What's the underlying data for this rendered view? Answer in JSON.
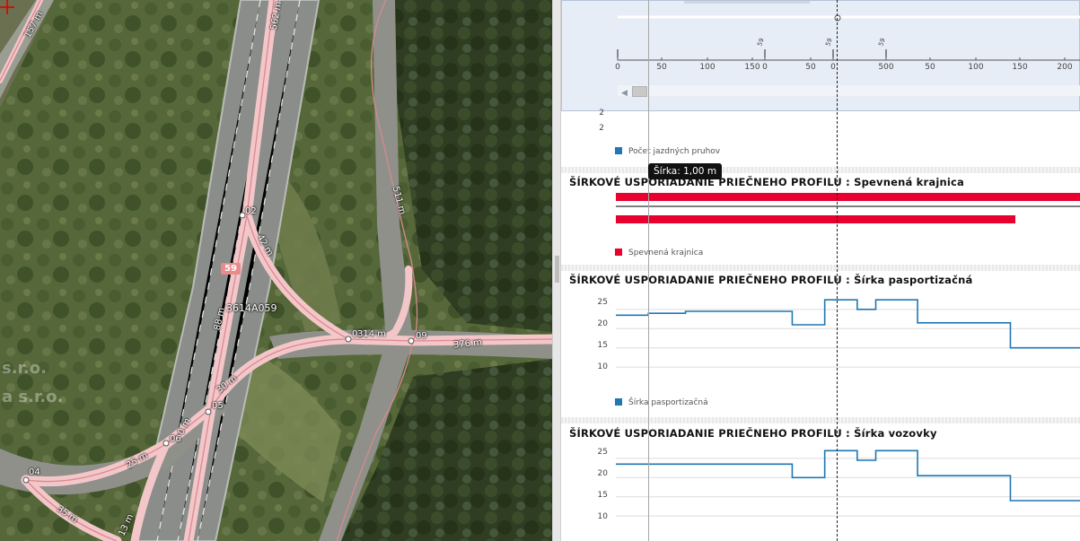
{
  "map": {
    "road_number": "59",
    "segment_id": "3614A059",
    "watermark_lines": [
      "s.r.o.",
      "a s.r.o."
    ],
    "labels": [
      {
        "text": "157 m",
        "name": "dist-157"
      },
      {
        "text": "562 m",
        "name": "dist-562"
      },
      {
        "text": "02",
        "name": "node-02"
      },
      {
        "text": "42 m",
        "name": "dist-42"
      },
      {
        "text": "511 m",
        "name": "dist-511"
      },
      {
        "text": "88 m",
        "name": "dist-88"
      },
      {
        "text": "03",
        "name": "node-03"
      },
      {
        "text": "314 m",
        "name": "dist-314"
      },
      {
        "text": "09",
        "name": "node-09"
      },
      {
        "text": "376 m",
        "name": "dist-376"
      },
      {
        "text": "30 m",
        "name": "dist-30"
      },
      {
        "text": "05",
        "name": "node-05"
      },
      {
        "text": "0 m",
        "name": "dist-0"
      },
      {
        "text": "06",
        "name": "node-06"
      },
      {
        "text": "25 m",
        "name": "dist-25"
      },
      {
        "text": "04",
        "name": "node-04"
      },
      {
        "text": "35 m",
        "name": "dist-35"
      },
      {
        "text": "13 m",
        "name": "dist-13"
      }
    ]
  },
  "overview": {
    "axis_ticks": [
      "0",
      "50",
      "100",
      "150",
      "0",
      "50",
      "0",
      "500",
      "50",
      "100",
      "150",
      "200"
    ],
    "markers": [
      "59",
      "59",
      "59"
    ],
    "cursor_marker": "0"
  },
  "tooltip": {
    "text": "Šírka: 1,00 m"
  },
  "sections": [
    {
      "id": "pocet",
      "title": "",
      "legend": "Počet jazdných pruhov",
      "legend_color": "#1f77b4",
      "y_ticks": [
        "2"
      ]
    },
    {
      "id": "krajnica",
      "title": "ŠÍRKOVÉ USPORIADANIE PRIEČNEHO PROFILU : Spevnená krajnica",
      "legend": "Spevnená krajnica",
      "legend_color": "#e8002e"
    },
    {
      "id": "pasport",
      "title": "ŠÍRKOVÉ USPORIADANIE PRIEČNEHO PROFILU : Šírka pasportizačná",
      "legend": "Šírka pasportizačná",
      "legend_color": "#1f77b4",
      "y_ticks": [
        "25",
        "20",
        "15",
        "10"
      ]
    },
    {
      "id": "vozovka",
      "title": "ŠÍRKOVÉ USPORIADANIE PRIEČNEHO PROFILU : Šírka vozovky",
      "legend": "",
      "legend_color": "#1f77b4",
      "y_ticks": [
        "25",
        "20",
        "15",
        "10"
      ]
    }
  ],
  "chart_data": [
    {
      "type": "line",
      "title": "ŠÍRKOVÉ USPORIADANIE PRIEČNEHO PROFILU : Šírka pasportizačná",
      "series": [
        {
          "name": "Šírka pasportizačná",
          "color": "#1f77b4",
          "steps": [
            [
              0,
              23.5
            ],
            [
              0.07,
              24
            ],
            [
              0.15,
              24.5
            ],
            [
              0.38,
              21
            ],
            [
              0.45,
              27.5
            ],
            [
              0.52,
              25
            ],
            [
              0.56,
              27.5
            ],
            [
              0.65,
              21.5
            ],
            [
              0.85,
              15
            ],
            [
              1.0,
              15
            ]
          ]
        }
      ],
      "ylim": [
        7,
        28
      ]
    },
    {
      "type": "line",
      "title": "ŠÍRKOVÉ USPORIADANIE PRIEČNEHO PROFILU : Šírka vozovky",
      "series": [
        {
          "name": "",
          "color": "#1f77b4",
          "steps": [
            [
              0,
              23.5
            ],
            [
              0.38,
              20
            ],
            [
              0.45,
              27
            ],
            [
              0.52,
              24.5
            ],
            [
              0.56,
              27
            ],
            [
              0.65,
              20.5
            ],
            [
              0.85,
              14
            ],
            [
              1.0,
              14
            ]
          ]
        }
      ],
      "ylim": [
        7,
        28
      ]
    }
  ]
}
